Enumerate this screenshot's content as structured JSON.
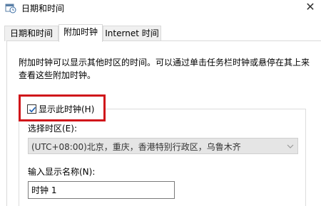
{
  "window": {
    "title": "日期和时间",
    "close_glyph": "✕"
  },
  "tabs": [
    {
      "label": "日期和时间",
      "active": false
    },
    {
      "label": "附加时钟",
      "active": true
    },
    {
      "label": "Internet 时间",
      "active": false
    }
  ],
  "panel": {
    "description": "附加时钟可以显示其他时区的时间。可以通过单击任务栏时钟或悬停在其上来查看这些附加时钟。",
    "clock1": {
      "show_checkbox_label": "显示此时钟(H)",
      "show_checked": true,
      "timezone_label": "选择时区(E):",
      "timezone_value": "(UTC+08:00)北京，重庆，香港特别行政区，乌鲁木齐",
      "name_label": "输入显示名称(N):",
      "name_value": "时钟 1"
    }
  },
  "colors": {
    "highlight_border": "#d0141a",
    "checkmark": "#1a5fb4"
  },
  "icons": {
    "app": "calendar-clock-icon",
    "close": "close-icon",
    "checkbox": "checkmark-icon",
    "dropdown": "chevron-down-icon"
  }
}
